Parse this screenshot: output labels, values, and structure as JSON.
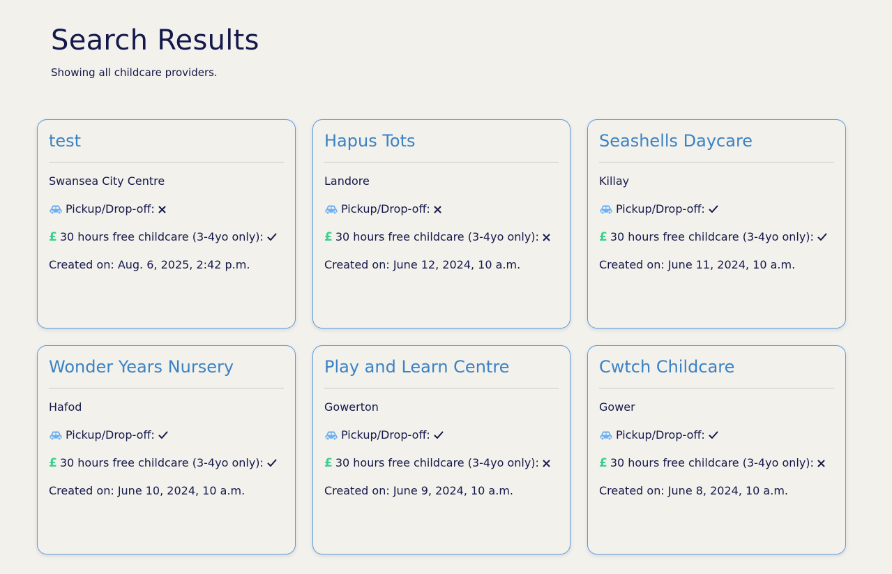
{
  "page": {
    "title": "Search Results",
    "subtitle": "Showing all childcare providers."
  },
  "labels": {
    "pickup": "Pickup/Drop-off:",
    "free_childcare": "30 hours free childcare (3-4yo only):",
    "pound_symbol": "£"
  },
  "providers": [
    {
      "name": "test",
      "location": "Swansea City Centre",
      "pickup": false,
      "free_childcare": true,
      "created": "Created on: Aug. 6, 2025, 2:42 p.m."
    },
    {
      "name": "Hapus Tots",
      "location": "Landore",
      "pickup": false,
      "free_childcare": false,
      "created": "Created on: June 12, 2024, 10 a.m."
    },
    {
      "name": "Seashells Daycare",
      "location": "Killay",
      "pickup": true,
      "free_childcare": true,
      "created": "Created on: June 11, 2024, 10 a.m."
    },
    {
      "name": "Wonder Years Nursery",
      "location": "Hafod",
      "pickup": true,
      "free_childcare": true,
      "created": "Created on: June 10, 2024, 10 a.m."
    },
    {
      "name": "Play and Learn Centre",
      "location": "Gowerton",
      "pickup": true,
      "free_childcare": false,
      "created": "Created on: June 9, 2024, 10 a.m."
    },
    {
      "name": "Cwtch Childcare",
      "location": "Gower",
      "pickup": true,
      "free_childcare": false,
      "created": "Created on: June 8, 2024, 10 a.m."
    }
  ],
  "colors": {
    "background": "#f2f1ec",
    "text": "#14184a",
    "card_title": "#3b82c4",
    "card_border": "#5b9be0",
    "car_icon": "#6fb0f0",
    "pound_icon": "#3ecf8e"
  }
}
